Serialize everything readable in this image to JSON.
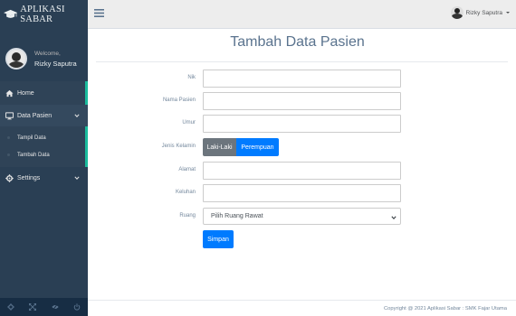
{
  "app": {
    "brand": "APLIKASI SABAR"
  },
  "profile": {
    "welcome": "Welcome,",
    "name": "Rizky Saputra"
  },
  "sidebar": {
    "items": [
      {
        "label": "Home",
        "icon": "home-icon"
      },
      {
        "label": "Data Pasien",
        "icon": "desktop-icon"
      },
      {
        "label": "Settings",
        "icon": "gear-icon"
      }
    ],
    "submenu": [
      {
        "label": "Tampil Data"
      },
      {
        "label": "Tambah Data"
      }
    ],
    "footer_icons": [
      "gear-icon",
      "fullscreen-icon",
      "eye-slash-icon",
      "power-icon"
    ]
  },
  "topnav": {
    "user": "Rizky Saputra"
  },
  "page": {
    "title": "Tambah Data Pasien"
  },
  "form": {
    "nik": {
      "label": "Nik",
      "value": ""
    },
    "nama": {
      "label": "Nama Pasien",
      "value": ""
    },
    "umur": {
      "label": "Umur",
      "value": ""
    },
    "jenis_kelamin": {
      "label": "Jenis Kelamin",
      "options": [
        "Laki-Laki",
        "Perempuan"
      ],
      "selected": "Perempuan"
    },
    "alamat": {
      "label": "Alamat",
      "value": ""
    },
    "keluhan": {
      "label": "Keluhan",
      "value": ""
    },
    "ruang": {
      "label": "Ruang",
      "selected": "Pilih Ruang Rawat"
    },
    "submit": "Simpan"
  },
  "footer": {
    "text": "Copyright @ 2021 Aplikasi Sabar : SMK Fajar Utama"
  },
  "colors": {
    "sidebar": "#2a3f54",
    "accent": "#1abb9c",
    "primary": "#007bff",
    "secondary": "#6c757d"
  }
}
